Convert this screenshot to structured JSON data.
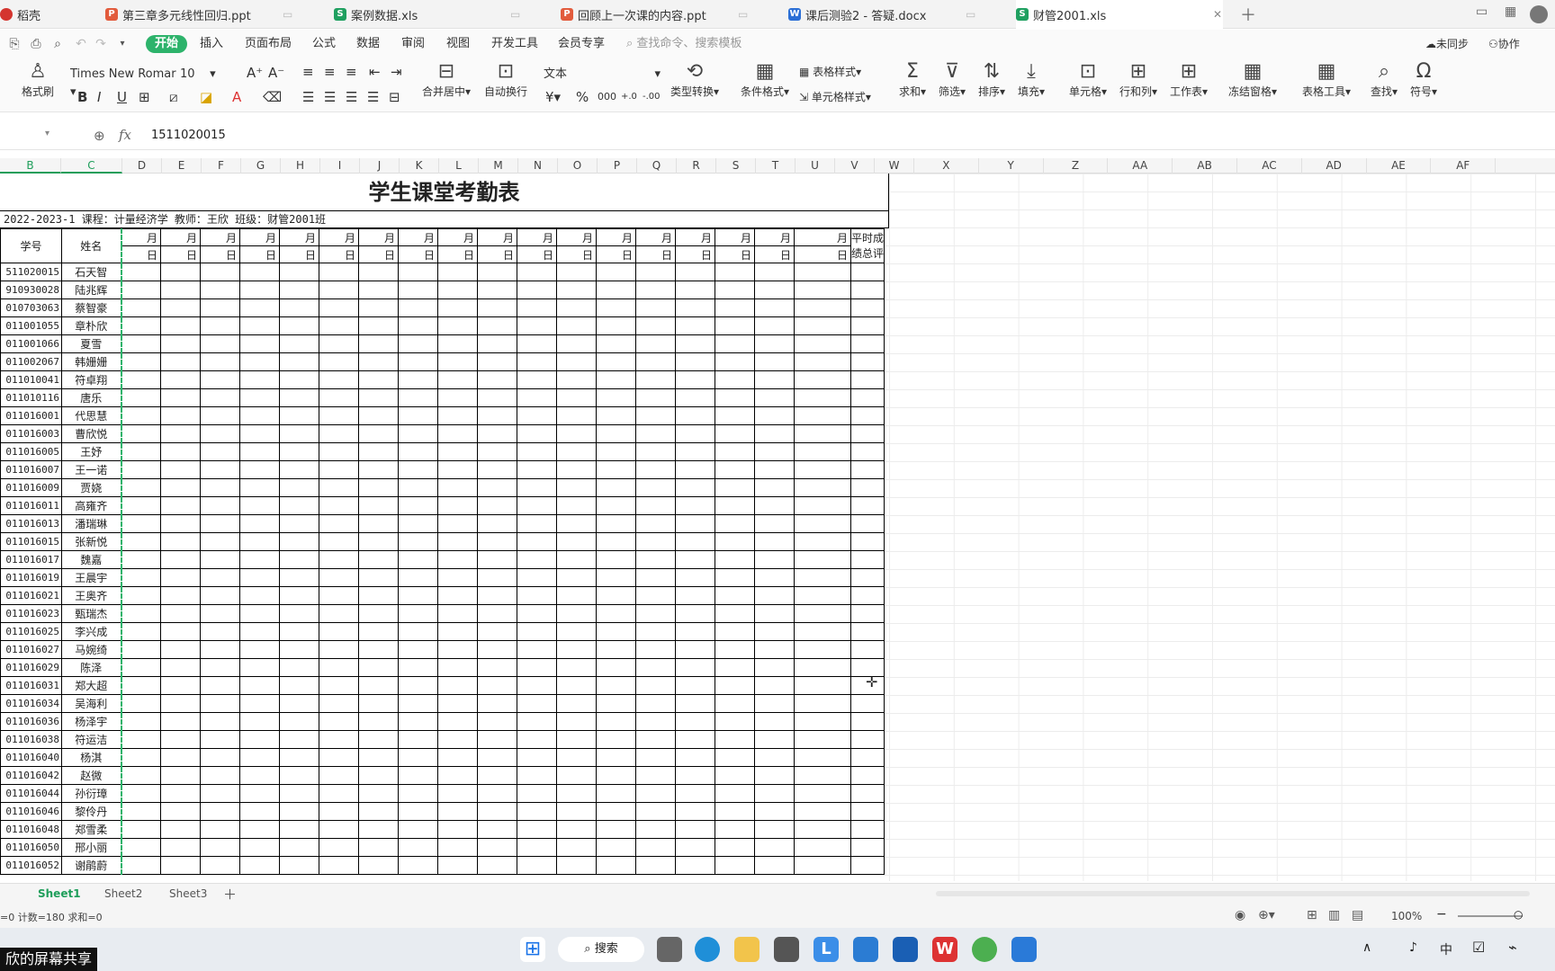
{
  "tabs": [
    {
      "name": "稻壳",
      "icon": "r"
    },
    {
      "name": "第三章多元线性回归.ppt",
      "icon": "p"
    },
    {
      "name": "案例数据.xls",
      "icon": "s"
    },
    {
      "name": "回顾上一次课的内容.ppt",
      "icon": "p"
    },
    {
      "name": "课后测验2 - 答疑.docx",
      "icon": "w"
    },
    {
      "name": "财管2001.xls",
      "icon": "s"
    }
  ],
  "menu": [
    "开始",
    "插入",
    "页面布局",
    "公式",
    "数据",
    "审阅",
    "视图",
    "开发工具",
    "会员专享"
  ],
  "search_placeholder": "查找命令、搜索模板",
  "right_menu": {
    "sync": "未同步",
    "collab": "协作"
  },
  "ribbon": {
    "format_painter": "格式刷",
    "font_name": "Times New Romar",
    "font_size": "10",
    "merge": "合并居中",
    "wrap": "自动换行",
    "number_format": "文本",
    "type_convert": "类型转换",
    "cond_format": "条件格式",
    "table_style": "表格样式",
    "cell_style": "单元格样式",
    "sum": "求和",
    "filter": "筛选",
    "sort": "排序",
    "fill": "填充",
    "cell": "单元格",
    "rowcol": "行和列",
    "worksheet": "工作表",
    "freeze": "冻结窗格",
    "table_tools": "表格工具",
    "find": "查找",
    "symbol": "符号"
  },
  "formula": {
    "fx": "fx",
    "value": "1511020015"
  },
  "columns": [
    "B",
    "C",
    "D",
    "E",
    "F",
    "G",
    "H",
    "I",
    "J",
    "K",
    "L",
    "M",
    "N",
    "O",
    "P",
    "Q",
    "R",
    "S",
    "T",
    "U",
    "V",
    "W",
    "X",
    "Y",
    "Z",
    "AA",
    "AB",
    "AC",
    "AD",
    "AE",
    "AF"
  ],
  "sheet": {
    "title": "学生课堂考勤表",
    "info": "2022-2023-1 课程：计量经济学 教师：王欣 班级：财管2001班",
    "h_id": "学号",
    "h_name": "姓名",
    "h_month": "月",
    "h_day": "日",
    "h_score1": "平时成",
    "h_score2": "绩总评",
    "students": [
      [
        "511020015",
        "石天智"
      ],
      [
        "910930028",
        "陆兆辉"
      ],
      [
        "010703063",
        "蔡智豪"
      ],
      [
        "011001055",
        "章朴欣"
      ],
      [
        "011001066",
        "夏雪"
      ],
      [
        "011002067",
        "韩姗姗"
      ],
      [
        "011010041",
        "符卓翔"
      ],
      [
        "011010116",
        "唐乐"
      ],
      [
        "011016001",
        "代思慧"
      ],
      [
        "011016003",
        "曹欣悦"
      ],
      [
        "011016005",
        "王妤"
      ],
      [
        "011016007",
        "王一诺"
      ],
      [
        "011016009",
        "贾娆"
      ],
      [
        "011016011",
        "高雍齐"
      ],
      [
        "011016013",
        "潘瑞琳"
      ],
      [
        "011016015",
        "张新悦"
      ],
      [
        "011016017",
        "魏嘉"
      ],
      [
        "011016019",
        "王晨宇"
      ],
      [
        "011016021",
        "王奥齐"
      ],
      [
        "011016023",
        "甄瑞杰"
      ],
      [
        "011016025",
        "李兴成"
      ],
      [
        "011016027",
        "马婉绮"
      ],
      [
        "011016029",
        "陈泽"
      ],
      [
        "011016031",
        "郑大超"
      ],
      [
        "011016034",
        "吴海利"
      ],
      [
        "011016036",
        "杨泽宇"
      ],
      [
        "011016038",
        "符运洁"
      ],
      [
        "011016040",
        "杨淇"
      ],
      [
        "011016042",
        "赵微"
      ],
      [
        "011016044",
        "孙衍璋"
      ],
      [
        "011016046",
        "黎伶丹"
      ],
      [
        "011016048",
        "郑雪柔"
      ],
      [
        "011016050",
        "邢小丽"
      ],
      [
        "011016052",
        "谢鹃蔚"
      ]
    ]
  },
  "sheet_tabs": [
    "Sheet1",
    "Sheet2",
    "Sheet3"
  ],
  "status": {
    "stats": "=0  计数=180  求和=0",
    "zoom": "100%"
  },
  "taskbar": {
    "search": "搜索"
  },
  "share_banner": "欣的屏幕共享",
  "ime": "中"
}
